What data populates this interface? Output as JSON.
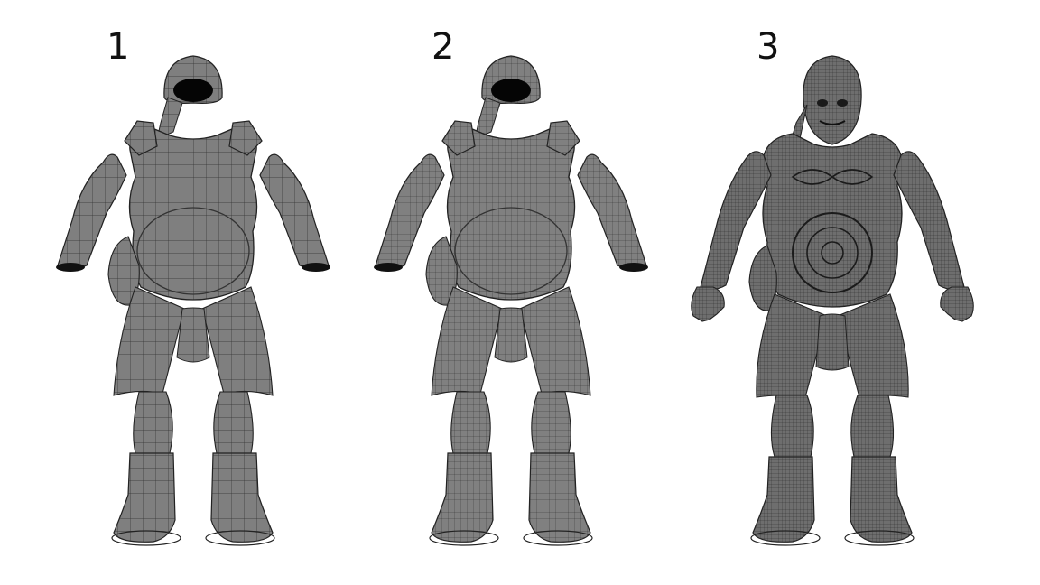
{
  "panels": [
    {
      "number": "1",
      "figure": "armor-model-low-density"
    },
    {
      "number": "2",
      "figure": "armor-model-medium-density"
    },
    {
      "number": "3",
      "figure": "character-with-armor-high-density"
    }
  ],
  "colors": {
    "background": "#ffffff",
    "mesh_fill": "#7f7f7f",
    "mesh_dark": "#3a3a3a",
    "wire": "#2a2a2a"
  }
}
